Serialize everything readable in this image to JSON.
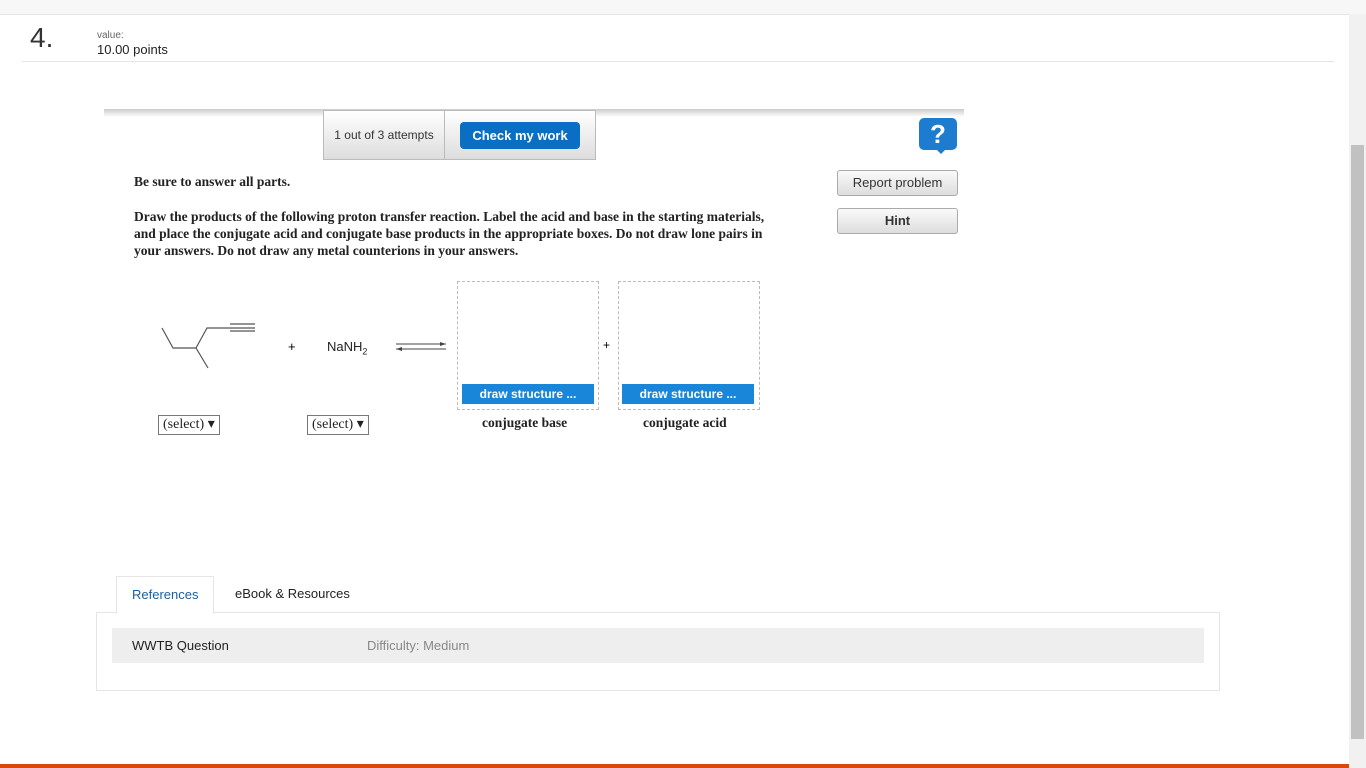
{
  "question": {
    "number": "4.",
    "value_label": "value:",
    "points": "10.00 points"
  },
  "toolbar": {
    "attempts": "1 out of 3 attempts",
    "check_label": "Check my work"
  },
  "side": {
    "help": "?",
    "report": "Report problem",
    "hint": "Hint"
  },
  "instructions": {
    "intro": "Be sure to answer all parts.",
    "body": "Draw the products of the following proton transfer reaction. Label the acid and base in the starting materials, and place the conjugate acid and conjugate base products in the appropriate boxes. Do not draw lone pairs in your answers. Do not draw any metal counterions in your answers."
  },
  "reaction": {
    "plus": "+",
    "reagent": "NaNH",
    "reagent_sub": "2",
    "select1": "(select) ▾",
    "select2": "(select) ▾",
    "boxes": [
      {
        "button": "draw structure ...",
        "label": "conjugate base"
      },
      {
        "button": "draw structure ...",
        "label": "conjugate acid"
      }
    ]
  },
  "tabs": [
    {
      "label": "References",
      "active": true
    },
    {
      "label": "eBook & Resources",
      "active": false
    }
  ],
  "references": {
    "type": "WWTB Question",
    "difficulty": "Difficulty: Medium"
  },
  "colors": {
    "accent": "#0a6fc2",
    "bottom_bar": "#d9480f"
  }
}
